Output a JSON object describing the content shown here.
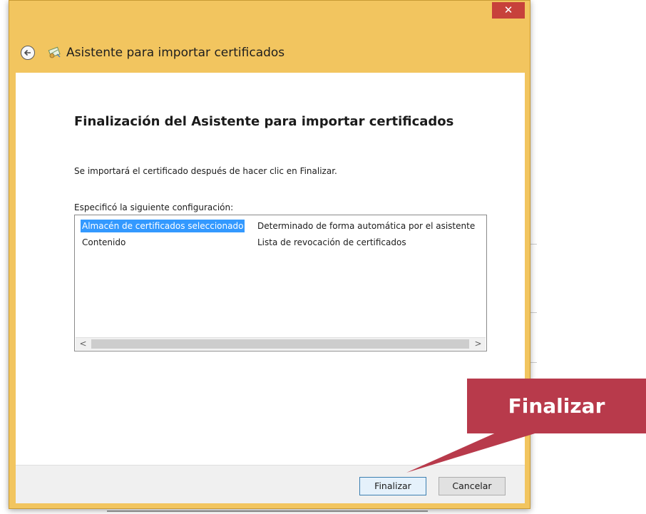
{
  "window": {
    "title": "Asistente para importar certificados",
    "close_label": "✕"
  },
  "content": {
    "heading": "Finalización del Asistente para importar certificados",
    "intro": "Se importará el certificado después de hacer clic en Finalizar.",
    "config_label": "Especificó la siguiente configuración:",
    "settings": [
      {
        "key": "Almacén de certificados seleccionado",
        "value": "Determinado de forma automática por el asistente",
        "selected": true
      },
      {
        "key": "Contenido",
        "value": "Lista de revocación de certificados",
        "selected": false
      }
    ]
  },
  "buttons": {
    "finish": "Finalizar",
    "cancel": "Cancelar"
  },
  "callout": {
    "text": "Finalizar",
    "color": "#b83a4b"
  },
  "colors": {
    "window_frame": "#f2c55f",
    "close_button": "#c7413b",
    "selection": "#3399ff"
  }
}
